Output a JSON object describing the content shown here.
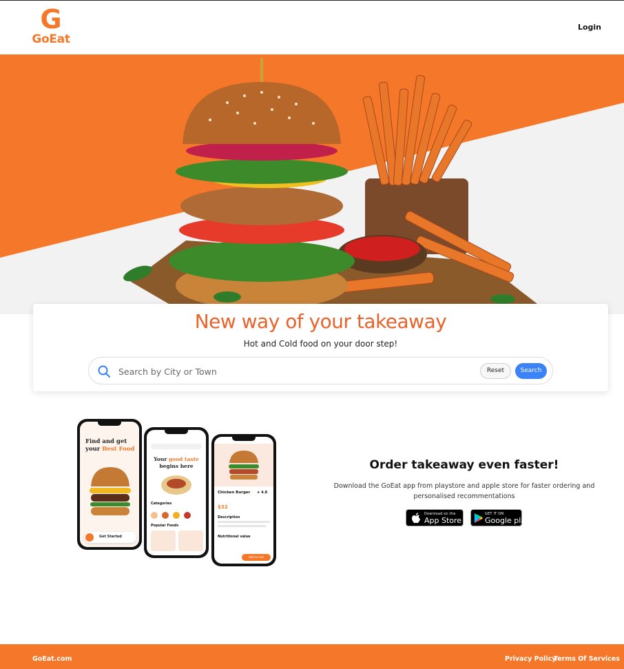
{
  "brand": {
    "logo_mark": "G",
    "name": "GoEat"
  },
  "header": {
    "login_label": "Login"
  },
  "hero": {
    "headline": "New way of your takeaway",
    "subline": "Hot and Cold food on your door step!"
  },
  "search": {
    "placeholder": "Search by City or Town",
    "reset_label": "Reset",
    "search_label": "Search"
  },
  "app_promo": {
    "heading": "Order takeaway even faster!",
    "description": "Download the GoEat app from playstore and apple store for faster ordering and personalised recommentations",
    "app_store": {
      "small": "Download on the",
      "big": "App Store"
    },
    "google_play": {
      "small": "GET IT ON",
      "big": "Google play"
    }
  },
  "phones": {
    "phone1": {
      "title_line1": "Find and get",
      "title_line2": "your",
      "title_accent": "Best Food",
      "cta": "Get Started"
    },
    "phone2": {
      "title_line1": "Your",
      "title_accent": "good taste",
      "title_line2": "begins here",
      "categories": "Categories",
      "popular": "Popular Foods"
    },
    "phone3": {
      "item": "Chicken Burger",
      "price": "$32",
      "rating": "4.8",
      "description": "Description",
      "nutrition": "Nutritional value",
      "add": "Add to cart"
    }
  },
  "footer": {
    "brand": "GoEat.com",
    "privacy": "Privacy Policy",
    "terms": "Terms Of Services"
  },
  "colors": {
    "accent": "#f5782a",
    "headline": "#e8622a",
    "search_button": "#3b82f6"
  }
}
